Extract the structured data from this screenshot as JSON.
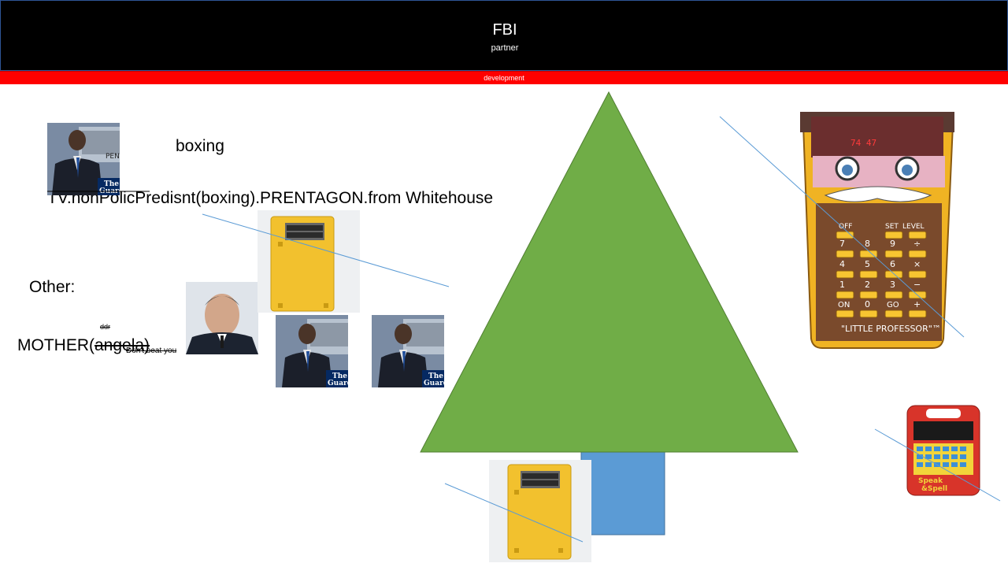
{
  "header": {
    "title": "FBI",
    "subtitle": "partner"
  },
  "banner": {
    "label": "development"
  },
  "texts": {
    "boxing": "boxing",
    "tv_line": "TV.nonPolicPredisnt(boxing).PRENTAGON.from Whitehouse",
    "other": "Other:",
    "ddr": "ddr",
    "mother_prefix": "MOTHER(",
    "mother_strike": "angela)",
    "dont_beat": "Don't beat you"
  },
  "photos": {
    "guardian_badge_line1": "The",
    "guardian_badge_line2": "Guardian",
    "pentagon_sign": "PENTAGON"
  },
  "calculator": {
    "display": "74 47",
    "brand": "\"LITTLE PROFESSOR\"™",
    "keys": [
      "OFF",
      "SET",
      "LEVEL",
      "7",
      "8",
      "9",
      "÷",
      "4",
      "5",
      "6",
      "×",
      "1",
      "2",
      "3",
      "−",
      "ON",
      "0",
      "GO",
      "+"
    ]
  },
  "speak_spell": {
    "brand_line1": "Speak",
    "brand_line2": "&Spell"
  },
  "colors": {
    "header_bg": "#000000",
    "banner_bg": "#ff0000",
    "tree_green": "#70ad47",
    "trunk_blue": "#5b9bd5",
    "connector_blue": "#5b9bd5",
    "battery_yellow": "#f2c12e"
  }
}
